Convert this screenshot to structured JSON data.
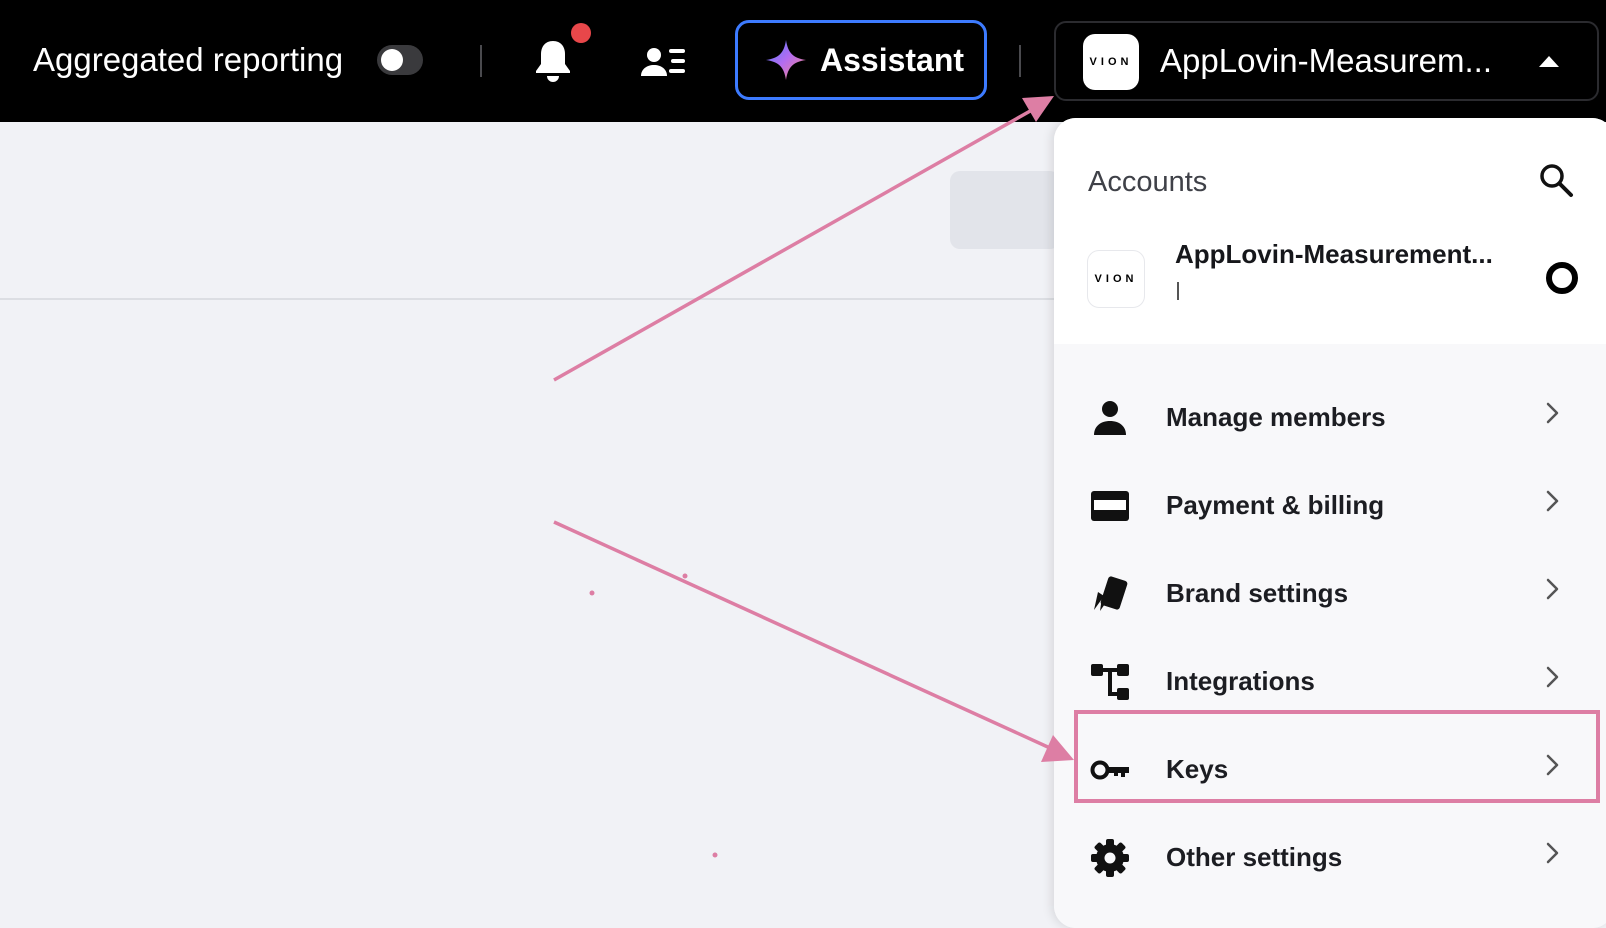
{
  "topbar": {
    "aggregated_label": "Aggregated reporting",
    "aggregated_enabled": false,
    "assistant_label": "Assistant",
    "account_name": "AppLovin-Measurem...",
    "logo_text": "VION"
  },
  "panel": {
    "title": "Accounts",
    "account": {
      "name": "AppLovin-Measurement...",
      "logo_text": "VION",
      "selected": true
    },
    "menu": [
      {
        "label": "Manage members",
        "icon": "person-icon"
      },
      {
        "label": "Payment & billing",
        "icon": "credit-card-icon"
      },
      {
        "label": "Brand settings",
        "icon": "brand-tag-icon"
      },
      {
        "label": "Integrations",
        "icon": "integrations-icon"
      },
      {
        "label": "Keys",
        "icon": "key-icon"
      },
      {
        "label": "Other settings",
        "icon": "gear-icon"
      }
    ]
  },
  "colors": {
    "topbar_bg": "#000000",
    "page_bg": "#f1f2f6",
    "assistant_border": "#3d7bff",
    "notification_dot": "#e8474a",
    "annotation": "#dd7ea4"
  }
}
